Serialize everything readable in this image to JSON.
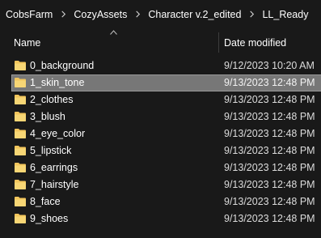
{
  "breadcrumb": [
    "CobsFarm",
    "CozyAssets",
    "Character v.2_edited",
    "LL_Ready"
  ],
  "columns": {
    "name": "Name",
    "date_modified": "Date modified"
  },
  "colors": {
    "background": "#191919",
    "selected_row": "#777777",
    "folder": "#f2c55c"
  },
  "rows": [
    {
      "name": "0_background",
      "date": "9/12/2023 10:20 AM",
      "selected": false
    },
    {
      "name": "1_skin_tone",
      "date": "9/13/2023 12:48 PM",
      "selected": true
    },
    {
      "name": "2_clothes",
      "date": "9/13/2023 12:48 PM",
      "selected": false
    },
    {
      "name": "3_blush",
      "date": "9/13/2023 12:48 PM",
      "selected": false
    },
    {
      "name": "4_eye_color",
      "date": "9/13/2023 12:48 PM",
      "selected": false
    },
    {
      "name": "5_lipstick",
      "date": "9/13/2023 12:48 PM",
      "selected": false
    },
    {
      "name": "6_earrings",
      "date": "9/13/2023 12:48 PM",
      "selected": false
    },
    {
      "name": "7_hairstyle",
      "date": "9/13/2023 12:48 PM",
      "selected": false
    },
    {
      "name": "8_face",
      "date": "9/13/2023 12:48 PM",
      "selected": false
    },
    {
      "name": "9_shoes",
      "date": "9/13/2023 12:48 PM",
      "selected": false
    }
  ],
  "icons": {
    "separator": "chevron-right-icon",
    "folder": "folder-icon",
    "sort": "sort-ascending-icon"
  }
}
